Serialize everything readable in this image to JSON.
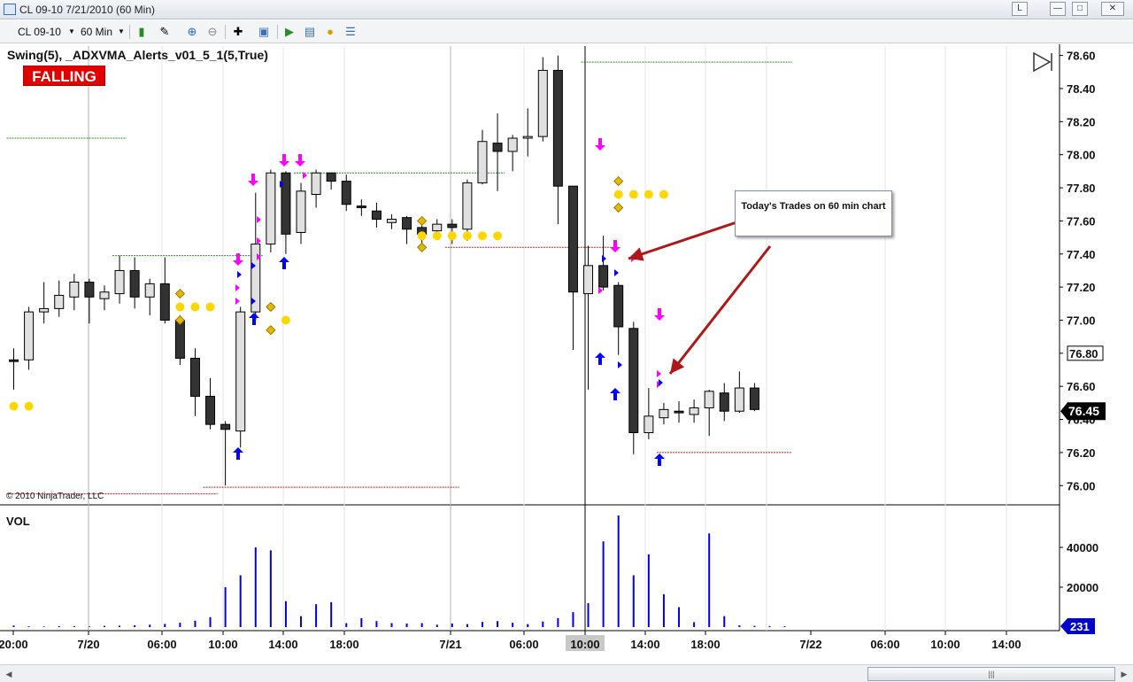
{
  "window": {
    "title": "CL 09-10  7/21/2010 (60 Min)"
  },
  "toolbar": {
    "instrument": "CL 09-10",
    "period": "60 Min"
  },
  "indicator": {
    "name": "Swing(5),  _ADXVMA_Alerts_v01_5_1(5,True)",
    "state": "FALLING"
  },
  "copyright": "© 2010 NinjaTrader, LLC",
  "volume_panel": {
    "label": "VOL",
    "current": "231"
  },
  "callout": {
    "text": "Today's Trades on 60 min chart"
  },
  "price_axis": {
    "ticks": [
      "78.60",
      "78.40",
      "78.20",
      "78.00",
      "77.80",
      "77.60",
      "77.40",
      "77.20",
      "77.00",
      "76.80",
      "76.60",
      "76.40",
      "76.20",
      "76.00"
    ],
    "last_price": "76.45",
    "overlap_label": "76.80"
  },
  "vol_axis": {
    "ticks": [
      "40000",
      "20000"
    ]
  },
  "time_axis": {
    "labels": [
      "20:00",
      "7/20",
      "06:00",
      "10:00",
      "14:00",
      "18:00",
      "7/21",
      "06:00",
      "10:00",
      "14:00",
      "18:00",
      "7/22",
      "06:00",
      "10:00",
      "14:00"
    ],
    "highlight": "10:00"
  },
  "colors": {
    "up": "#e0e0e0",
    "down": "#333333",
    "volume": "#0000ee",
    "dot": "#ffd700",
    "diamond": "#e6b800",
    "sell_arrow": "#ff00ff",
    "buy_arrow": "#0000ff",
    "falling_bg": "#e00000",
    "annotation_arrow": "#b01818"
  },
  "chart_data": {
    "type": "candlestick",
    "candles": [
      {
        "o": 76.76,
        "h": 76.83,
        "l": 76.58,
        "c": 76.75
      },
      {
        "o": 76.76,
        "h": 77.08,
        "l": 76.7,
        "c": 77.05
      },
      {
        "o": 77.05,
        "h": 77.23,
        "l": 76.98,
        "c": 77.07
      },
      {
        "o": 77.07,
        "h": 77.24,
        "l": 77.02,
        "c": 77.15
      },
      {
        "o": 77.14,
        "h": 77.28,
        "l": 77.06,
        "c": 77.23
      },
      {
        "o": 77.23,
        "h": 77.25,
        "l": 76.98,
        "c": 77.14
      },
      {
        "o": 77.13,
        "h": 77.21,
        "l": 77.06,
        "c": 77.17
      },
      {
        "o": 77.16,
        "h": 77.39,
        "l": 77.1,
        "c": 77.3
      },
      {
        "o": 77.3,
        "h": 77.38,
        "l": 77.07,
        "c": 77.14
      },
      {
        "o": 77.14,
        "h": 77.25,
        "l": 77.03,
        "c": 77.22
      },
      {
        "o": 77.22,
        "h": 77.38,
        "l": 76.98,
        "c": 77.0
      },
      {
        "o": 77.0,
        "h": 77.03,
        "l": 76.73,
        "c": 76.77
      },
      {
        "o": 76.77,
        "h": 76.83,
        "l": 76.42,
        "c": 76.54
      },
      {
        "o": 76.54,
        "h": 76.65,
        "l": 76.34,
        "c": 76.37
      },
      {
        "o": 76.37,
        "h": 76.39,
        "l": 76.0,
        "c": 76.34
      },
      {
        "o": 76.33,
        "h": 77.08,
        "l": 76.23,
        "c": 77.05
      },
      {
        "o": 77.05,
        "h": 77.77,
        "l": 77.0,
        "c": 77.46
      },
      {
        "o": 77.46,
        "h": 77.91,
        "l": 77.41,
        "c": 77.89
      },
      {
        "o": 77.89,
        "h": 77.9,
        "l": 77.4,
        "c": 77.52
      },
      {
        "o": 77.53,
        "h": 77.83,
        "l": 77.46,
        "c": 77.78
      },
      {
        "o": 77.76,
        "h": 77.91,
        "l": 77.68,
        "c": 77.89
      },
      {
        "o": 77.89,
        "h": 77.89,
        "l": 77.79,
        "c": 77.84
      },
      {
        "o": 77.84,
        "h": 77.88,
        "l": 77.66,
        "c": 77.7
      },
      {
        "o": 77.69,
        "h": 77.73,
        "l": 77.63,
        "c": 77.68
      },
      {
        "o": 77.66,
        "h": 77.71,
        "l": 77.56,
        "c": 77.61
      },
      {
        "o": 77.59,
        "h": 77.64,
        "l": 77.55,
        "c": 77.61
      },
      {
        "o": 77.62,
        "h": 77.63,
        "l": 77.46,
        "c": 77.55
      },
      {
        "o": 77.56,
        "h": 77.59,
        "l": 77.46,
        "c": 77.52
      },
      {
        "o": 77.54,
        "h": 77.61,
        "l": 77.51,
        "c": 77.58
      },
      {
        "o": 77.58,
        "h": 77.61,
        "l": 77.46,
        "c": 77.56
      },
      {
        "o": 77.55,
        "h": 77.85,
        "l": 77.48,
        "c": 77.83
      },
      {
        "o": 77.83,
        "h": 78.15,
        "l": 77.82,
        "c": 78.08
      },
      {
        "o": 78.07,
        "h": 78.25,
        "l": 77.78,
        "c": 78.02
      },
      {
        "o": 78.02,
        "h": 78.12,
        "l": 77.9,
        "c": 78.1
      },
      {
        "o": 78.1,
        "h": 78.28,
        "l": 77.99,
        "c": 78.11
      },
      {
        "o": 78.11,
        "h": 78.59,
        "l": 78.08,
        "c": 78.51
      },
      {
        "o": 78.51,
        "h": 78.6,
        "l": 77.58,
        "c": 77.81
      },
      {
        "o": 77.81,
        "h": 77.79,
        "l": 76.82,
        "c": 77.17
      },
      {
        "o": 77.16,
        "h": 77.45,
        "l": 76.58,
        "c": 77.33
      },
      {
        "o": 77.33,
        "h": 77.51,
        "l": 77.18,
        "c": 77.2
      },
      {
        "o": 77.21,
        "h": 77.23,
        "l": 76.79,
        "c": 76.96
      },
      {
        "o": 76.95,
        "h": 76.99,
        "l": 76.19,
        "c": 76.32
      },
      {
        "o": 76.32,
        "h": 76.59,
        "l": 76.28,
        "c": 76.42
      },
      {
        "o": 76.41,
        "h": 76.5,
        "l": 76.37,
        "c": 76.46
      },
      {
        "o": 76.45,
        "h": 76.51,
        "l": 76.38,
        "c": 76.44
      },
      {
        "o": 76.43,
        "h": 76.52,
        "l": 76.38,
        "c": 76.47
      },
      {
        "o": 76.47,
        "h": 76.58,
        "l": 76.3,
        "c": 76.57
      },
      {
        "o": 76.56,
        "h": 76.62,
        "l": 76.39,
        "c": 76.45
      },
      {
        "o": 76.45,
        "h": 76.69,
        "l": 76.44,
        "c": 76.59
      },
      {
        "o": 76.59,
        "h": 76.62,
        "l": 76.45,
        "c": 76.46
      }
    ],
    "volume": [
      800,
      400,
      300,
      500,
      500,
      300,
      600,
      700,
      900,
      1200,
      1600,
      2200,
      3200,
      5000,
      20000,
      26000,
      40000,
      38500,
      13000,
      5500,
      11500,
      12500,
      2000,
      4500,
      3000,
      2000,
      1800,
      2000,
      1200,
      1800,
      1500,
      2600,
      3000,
      2200,
      1500,
      2800,
      4500,
      7500,
      12000,
      43000,
      56000,
      26000,
      36500,
      16500,
      10000,
      2500,
      47000,
      5500,
      900,
      600,
      500,
      400
    ],
    "dots": [
      [
        0,
        76.48
      ],
      [
        1,
        76.48
      ],
      [
        11,
        77.08
      ],
      [
        12,
        77.08
      ],
      [
        13,
        77.08
      ],
      [
        18,
        77.0
      ],
      [
        27,
        77.51
      ],
      [
        28,
        77.51
      ],
      [
        29,
        77.51
      ],
      [
        30,
        77.51
      ],
      [
        31,
        77.51
      ],
      [
        32,
        77.51
      ],
      [
        40,
        77.76
      ],
      [
        41,
        77.76
      ],
      [
        42,
        77.76
      ],
      [
        43,
        77.76
      ]
    ],
    "diamonds": [
      [
        11,
        77.16
      ],
      [
        11,
        77.0
      ],
      [
        17,
        77.08
      ],
      [
        17,
        76.94
      ],
      [
        27,
        77.6
      ],
      [
        27,
        77.44
      ],
      [
        40,
        77.84
      ],
      [
        40,
        77.68
      ]
    ],
    "swing_lines": [
      {
        "from": 0,
        "to": 7,
        "price": 78.1,
        "color": "#2e8b2e"
      },
      {
        "from": 7,
        "to": 16,
        "price": 77.39,
        "color": "#2e8b2e"
      },
      {
        "from": 19,
        "to": 32,
        "price": 77.89,
        "color": "#2e8b2e"
      },
      {
        "from": 38,
        "to": 51,
        "price": 78.56,
        "color": "#2e8b2e"
      },
      {
        "from": 0,
        "to": 13,
        "price": 75.95,
        "color": "#c02020"
      },
      {
        "from": 13,
        "to": 29,
        "price": 75.99,
        "color": "#c02020"
      },
      {
        "from": 29,
        "to": 39,
        "price": 77.44,
        "color": "#c02020"
      },
      {
        "from": 43,
        "to": 51,
        "price": 76.2,
        "color": "#c02020"
      }
    ]
  }
}
